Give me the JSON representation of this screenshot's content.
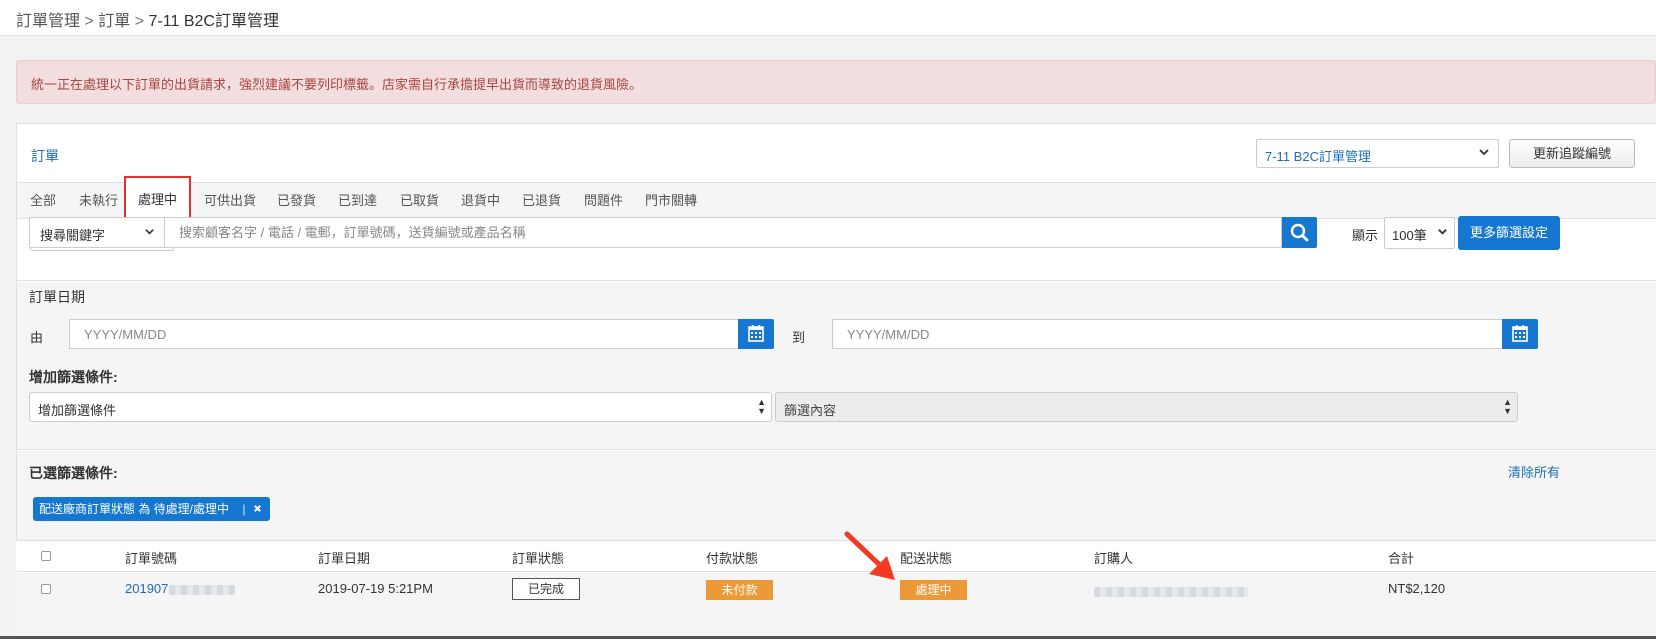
{
  "breadcrumb": {
    "items": [
      "訂單管理",
      "訂單",
      "7-11 B2C訂單管理"
    ],
    "separator": ">"
  },
  "alert": {
    "message": "統一正在處理以下訂單的出貨請求，強烈建議不要列印標籤。店家需自行承擔提早出貨而導致的退貨風險。"
  },
  "panel": {
    "title": "訂單",
    "shipping_select": "7-11 B2C訂單管理",
    "update_tracking_button": "更新追蹤編號"
  },
  "tabs": [
    "全部",
    "未執行",
    "處理中",
    "可供出貨",
    "已發貨",
    "已到達",
    "已取貨",
    "退貨中",
    "已退貨",
    "問題件",
    "門市關轉"
  ],
  "active_tab": "處理中",
  "search": {
    "field_select": "搜尋關鍵字",
    "placeholder": "搜索顧客名字 / 電話 / 電郵，訂單號碼，送貨編號或產品名稱",
    "show_label": "顯示",
    "page_size": "100筆",
    "more_filters_button": "更多篩選設定"
  },
  "date_filter": {
    "title": "訂單日期",
    "from_label": "由",
    "to_label": "到",
    "from_placeholder": "YYYY/MM/DD",
    "to_placeholder": "YYYY/MM/DD"
  },
  "add_filter": {
    "title": "增加篩選條件:",
    "select_value": "增加篩選條件",
    "content_value": "篩選內容"
  },
  "selected_filters": {
    "title": "已選篩選條件:",
    "clear_all": "清除所有",
    "chips": [
      {
        "label": "配送廠商訂單狀態 為 待處理/處理中"
      }
    ]
  },
  "table": {
    "columns": [
      "訂單號碼",
      "訂單日期",
      "訂單狀態",
      "付款狀態",
      "配送狀態",
      "訂購人",
      "合計"
    ],
    "rows": [
      {
        "order_number": "201907",
        "order_date": "2019-07-19 5:21PM",
        "order_status": "已完成",
        "payment_status": "未付款",
        "delivery_status": "處理中",
        "total": "NT$2,120"
      }
    ]
  },
  "colors": {
    "primary": "#1577d0",
    "link": "#1d6fb8",
    "alert_bg": "#f2dede",
    "alert_text": "#a94442",
    "badge_orange": "#ec9a37",
    "highlight_red": "#e4322b",
    "arrow_red": "#f03a21"
  },
  "icons": {
    "search": "search-icon",
    "calendar": "calendar-icon",
    "remove": "close-icon",
    "dropdown": "chevron-down-icon"
  }
}
